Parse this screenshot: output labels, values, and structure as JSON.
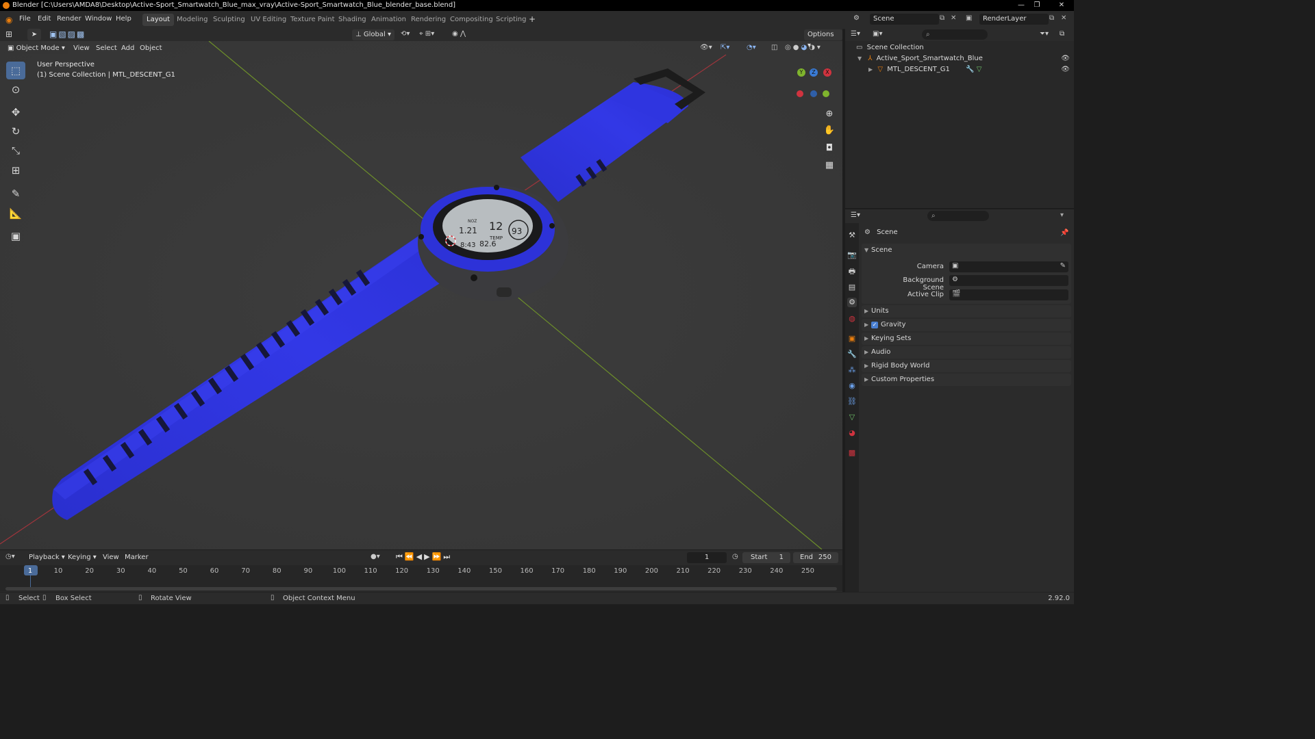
{
  "window": {
    "title": "Blender [C:\\Users\\AMDA8\\Desktop\\Active-Sport_Smartwatch_Blue_max_vray\\Active-Sport_Smartwatch_Blue_blender_base.blend]"
  },
  "menu": [
    "File",
    "Edit",
    "Render",
    "Window",
    "Help"
  ],
  "workspaces": [
    "Layout",
    "Modeling",
    "Sculpting",
    "UV Editing",
    "Texture Paint",
    "Shading",
    "Animation",
    "Rendering",
    "Compositing",
    "Scripting"
  ],
  "active_workspace": "Layout",
  "scene_selector": {
    "scene": "Scene",
    "view_layer": "RenderLayer"
  },
  "tool_header": {
    "orientation": "Global",
    "options": "Options"
  },
  "view_header": {
    "mode": "Object Mode",
    "menus": [
      "View",
      "Select",
      "Add",
      "Object"
    ]
  },
  "viewport": {
    "overlay_line1": "User Perspective",
    "overlay_line2": "(1) Scene Collection | MTL_DESCENT_G1",
    "gizmo_axes": {
      "x": "X",
      "y": "Y",
      "z": "Z"
    },
    "watch_face": {
      "a": "12",
      "b": "93",
      "c": "1.21",
      "d": "82.6",
      "e": "8:43",
      "f": "TEMP",
      "g": "NOZ"
    }
  },
  "left_tools": [
    "select-box",
    "cursor",
    "move",
    "rotate",
    "scale",
    "transform",
    "annotate",
    "measure",
    "add-cube"
  ],
  "outliner": {
    "root": "Scene Collection",
    "items": [
      {
        "label": "Active_Sport_Smartwatch_Blue"
      },
      {
        "label": "MTL_DESCENT_G1"
      }
    ]
  },
  "properties": {
    "context": "Scene",
    "panel_title": "Scene",
    "fields": [
      {
        "label": "Camera",
        "value": ""
      },
      {
        "label": "Background Scene",
        "value": ""
      },
      {
        "label": "Active Clip",
        "value": ""
      }
    ],
    "sections": [
      "Units",
      "Gravity",
      "Keying Sets",
      "Audio",
      "Rigid Body World",
      "Custom Properties"
    ],
    "gravity_checked": true
  },
  "timeline": {
    "menus": [
      "Playback",
      "Keying",
      "View",
      "Marker"
    ],
    "current_frame": "1",
    "start_label": "Start",
    "start": "1",
    "end_label": "End",
    "end": "250",
    "ticks": [
      "1",
      "10",
      "20",
      "30",
      "40",
      "50",
      "60",
      "70",
      "80",
      "90",
      "100",
      "110",
      "120",
      "130",
      "140",
      "150",
      "160",
      "170",
      "180",
      "190",
      "200",
      "210",
      "220",
      "230",
      "240",
      "250"
    ]
  },
  "statusbar": {
    "select": "Select",
    "box_select": "Box Select",
    "rotate_view": "Rotate View",
    "context_menu": "Object Context Menu",
    "version": "2.92.0"
  },
  "colors": {
    "strap_blue": "#2b2fe0",
    "accent_blue": "#4a6b99",
    "x_axis": "#d0333f",
    "y_axis": "#7fb42d"
  }
}
